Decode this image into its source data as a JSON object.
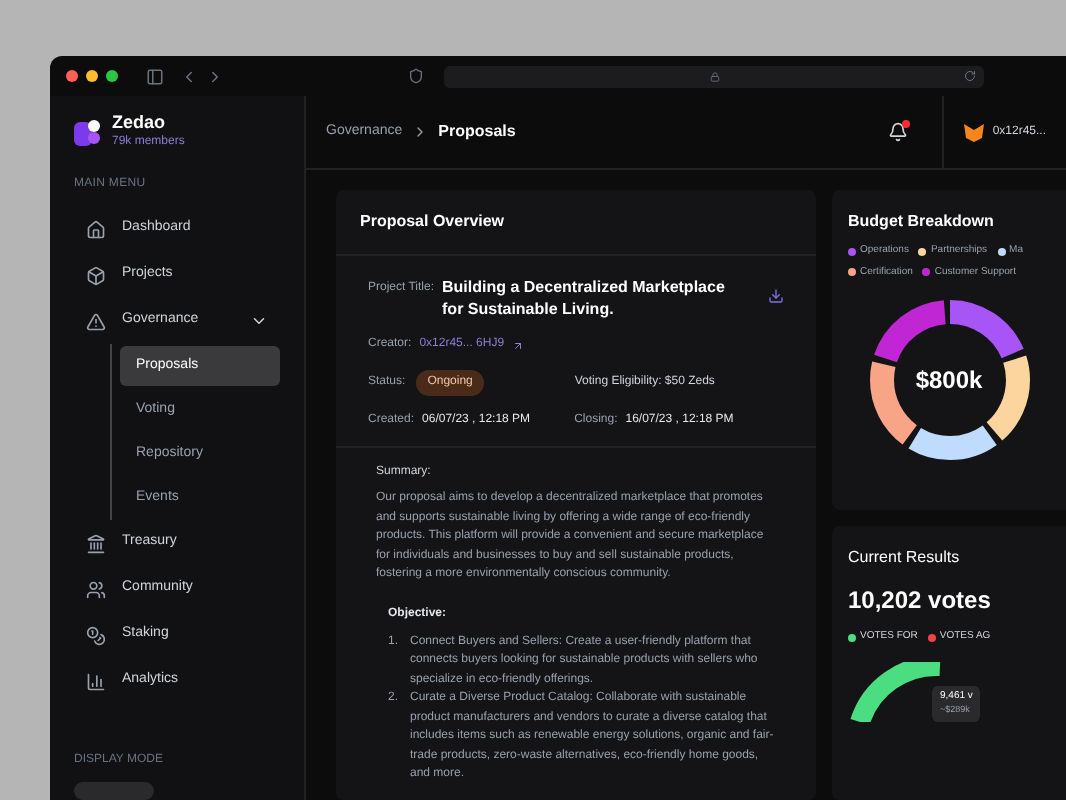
{
  "brand": {
    "name": "Zedao",
    "members": "79k members"
  },
  "menu_heading": "MAIN MENU",
  "nav": [
    {
      "label": "Dashboard",
      "selected": false
    },
    {
      "label": "Projects",
      "selected": false
    },
    {
      "label": "Governance",
      "selected": false,
      "expanded": true,
      "children": [
        {
          "label": "Proposals",
          "selected": true
        },
        {
          "label": "Voting",
          "selected": false
        },
        {
          "label": "Repository",
          "selected": false
        },
        {
          "label": "Events",
          "selected": false
        }
      ]
    },
    {
      "label": "Treasury",
      "selected": false
    },
    {
      "label": "Community",
      "selected": false
    },
    {
      "label": "Staking",
      "selected": false
    },
    {
      "label": "Analytics",
      "selected": false
    }
  ],
  "display_mode": {
    "heading": "DISPLAY MODE"
  },
  "breadcrumb": [
    "Governance",
    "Proposals"
  ],
  "notifications": {
    "unread": true
  },
  "account": "0x12r45...",
  "overview": {
    "title": "Proposal Overview",
    "project_title_label": "Project Title:",
    "project_title": "Building a Decentralized Marketplace for Sustainable Living.",
    "creator_label": "Creator:",
    "creator": "0x12r45... 6HJ9",
    "status_label": "Status:",
    "status": "Ongoing",
    "eligibility": "Voting Eligibility: $50 Zeds",
    "created_label": "Created:",
    "created": "06/07/23 , 12:18 PM",
    "closing_label": "Closing:",
    "closing": "16/07/23 , 12:18 PM",
    "summary_label": "Summary:",
    "summary": "Our proposal aims to develop a decentralized marketplace that promotes and supports sustainable living by offering a wide range of eco-friendly products. This platform will provide a convenient and secure marketplace for individuals and businesses to buy and sell sustainable products, fostering a more environmentally conscious community.",
    "objective_label": "Objective:",
    "objectives": [
      {
        "number": "1.",
        "text": "Connect Buyers and Sellers: Create a user-friendly platform that connects buyers looking for sustainable products with sellers who specialize in eco-friendly offerings."
      },
      {
        "number": "2.",
        "text": "Curate a Diverse Product Catalog: Collaborate with sustainable product manufacturers and vendors to curate a diverse catalog that includes items such as renewable energy solutions, organic and fair-trade products, zero-waste alternatives, eco-friendly home goods, and more."
      }
    ]
  },
  "budget": {
    "title": "Budget Breakdown",
    "total": "$800k",
    "legend": [
      {
        "label": "Operations",
        "color": "#a855f7"
      },
      {
        "label": "Partnerships",
        "color": "#fcd59e"
      },
      {
        "label": "Ma",
        "color": "#bfdbfe"
      },
      {
        "label": "Certification",
        "color": "#f8a487"
      },
      {
        "label": "Customer Support",
        "color": "#c026d3"
      }
    ]
  },
  "results": {
    "title": "Current Results",
    "total": "10,202 votes",
    "legend": [
      {
        "label": "VOTES FOR",
        "color": "#4ade80"
      },
      {
        "label": "VOTES AG",
        "color": "#ef4444"
      }
    ],
    "tooltip": [
      "9,461 v",
      "~$289k"
    ]
  }
}
